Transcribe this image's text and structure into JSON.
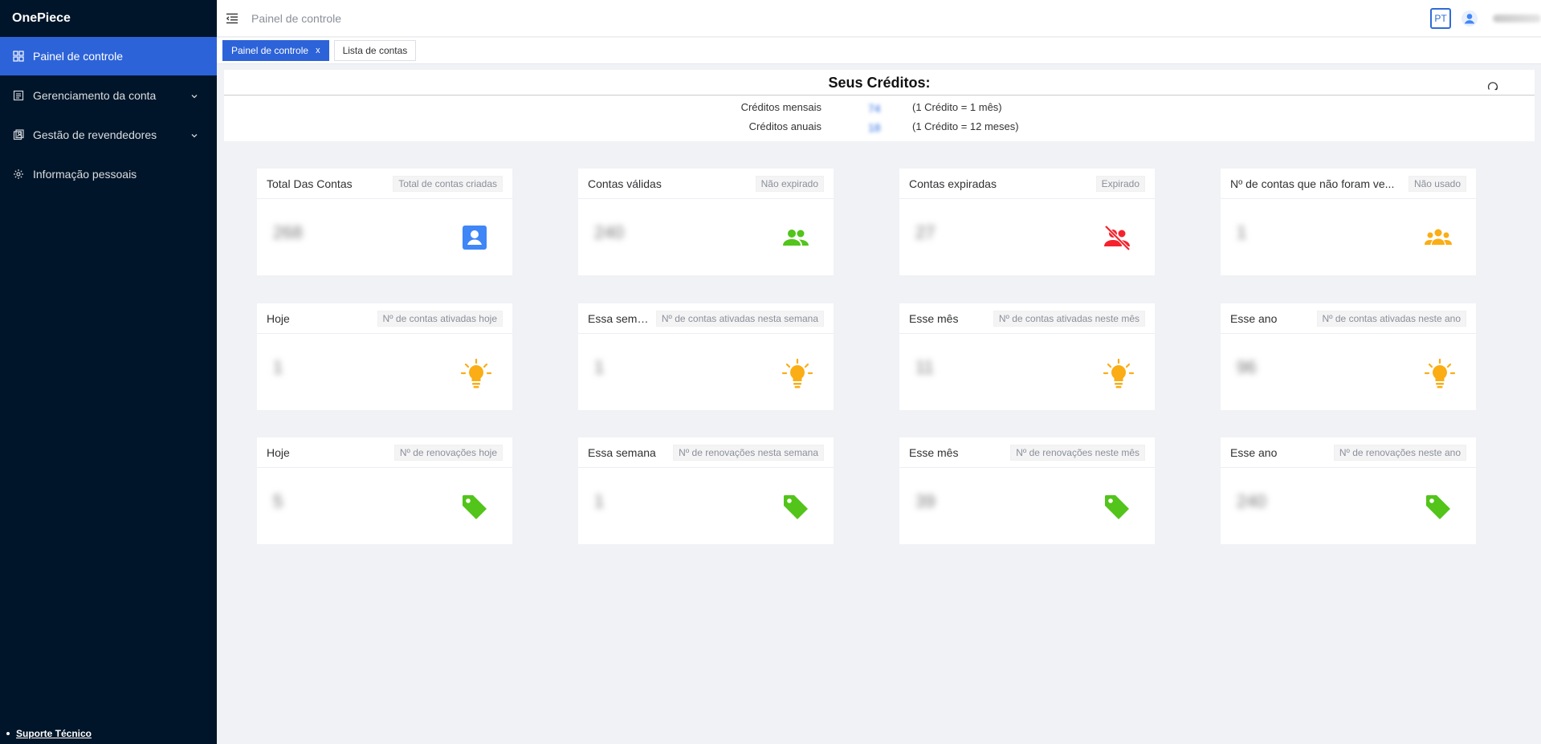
{
  "app": {
    "name": "OnePiece"
  },
  "sidebar": {
    "items": [
      {
        "label": "Painel de controle",
        "active": true,
        "icon": "dashboard-grid-icon"
      },
      {
        "label": "Gerenciamento da conta",
        "expandable": true,
        "icon": "list-icon"
      },
      {
        "label": "Gestão de revendedores",
        "expandable": true,
        "icon": "users-icon"
      },
      {
        "label": "Informação pessoais",
        "icon": "gear-icon"
      }
    ],
    "support_label": "Suporte Técnico"
  },
  "header": {
    "title": "Painel de controle",
    "lang": "PT"
  },
  "tabs": [
    {
      "label": "Painel de controle",
      "active": true,
      "close": "x"
    },
    {
      "label": "Lista de contas",
      "active": false
    }
  ],
  "credits": {
    "title": "Seus Créditos:",
    "monthly": {
      "label": "Créditos mensais",
      "note": "(1 Crédito = 1 mês)"
    },
    "annual": {
      "label": "Créditos anuais",
      "note": "(1 Crédito = 12 meses)"
    }
  },
  "colors": {
    "accent": "#2d63d8",
    "sidebar_bg": "#001529",
    "green": "#52c41a",
    "red": "#f5222d",
    "orange": "#faad14",
    "blue": "#3f86f7"
  },
  "cards": [
    {
      "title": "Total Das Contas",
      "tag": "Total de contas criadas",
      "icon": "person-badge-icon"
    },
    {
      "title": "Contas válidas",
      "tag": "Não expirado",
      "icon": "group-icon"
    },
    {
      "title": "Contas expiradas",
      "tag": "Expirado",
      "icon": "group-off-icon"
    },
    {
      "title": "Nº de contas que não foram ve...",
      "tag": "Não usado",
      "icon": "groups-icon"
    },
    {
      "title": "Hoje",
      "tag": "Nº de contas ativadas hoje",
      "icon": "lightbulb-icon"
    },
    {
      "title": "Essa semana",
      "tag": "Nº de contas ativadas nesta semana",
      "icon": "lightbulb-icon"
    },
    {
      "title": "Esse mês",
      "tag": "Nº de contas ativadas neste mês",
      "icon": "lightbulb-icon"
    },
    {
      "title": "Esse ano",
      "tag": "Nº de contas ativadas neste ano",
      "icon": "lightbulb-icon"
    },
    {
      "title": "Hoje",
      "tag": "Nº de renovações hoje",
      "icon": "price-tag-icon"
    },
    {
      "title": "Essa semana",
      "tag": "Nº de renovações nesta semana",
      "icon": "price-tag-icon"
    },
    {
      "title": "Esse mês",
      "tag": "Nº de renovações neste mês",
      "icon": "price-tag-icon"
    },
    {
      "title": "Esse ano",
      "tag": "Nº de renovações neste ano",
      "icon": "price-tag-icon"
    }
  ]
}
